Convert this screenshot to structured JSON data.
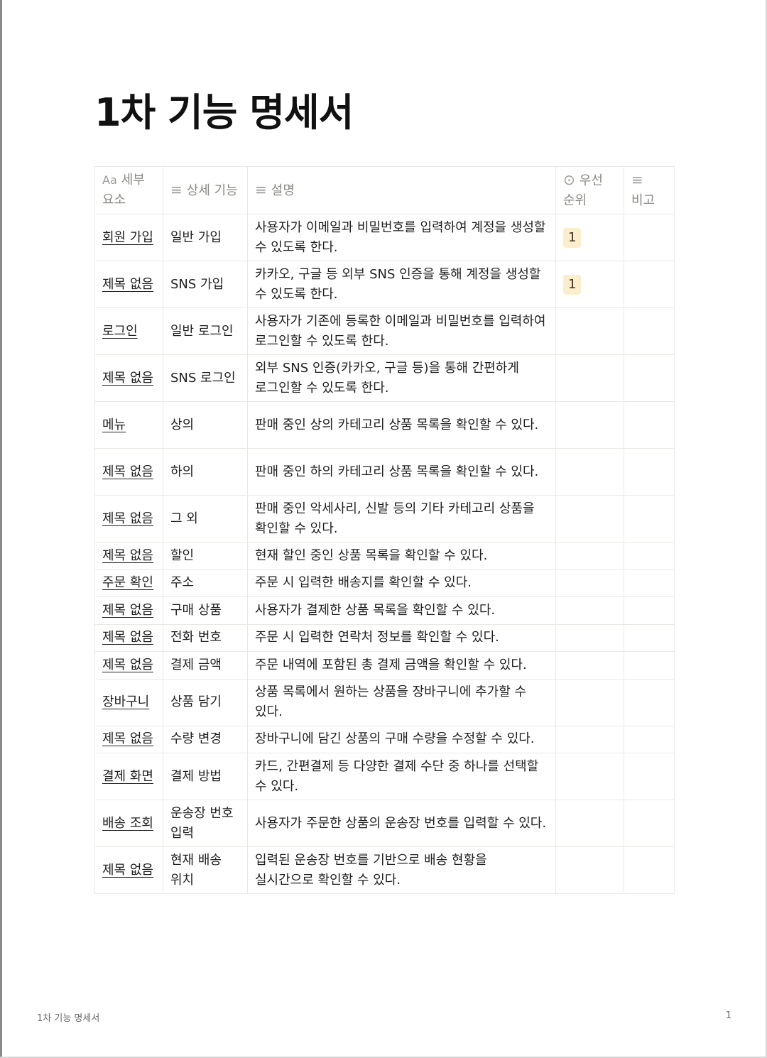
{
  "title": "1차 기능 명세서",
  "columns": [
    {
      "icon": "Aa",
      "label": "세부 요소"
    },
    {
      "icon": "≡",
      "label": "상세 기능"
    },
    {
      "icon": "≡",
      "label": "설명"
    },
    {
      "icon": "⊙",
      "label": "우선 순위"
    },
    {
      "icon": "≡",
      "label": "비고"
    }
  ],
  "rows": [
    {
      "element": "회원 가입",
      "feature": "일반 가입",
      "desc": "사용자가 이메일과 비밀번호를 입력하여 계정을 생성할 수 있도록 한다.",
      "priority": "1",
      "note": ""
    },
    {
      "element": "제목 없음",
      "feature": "SNS 가입",
      "desc": "카카오, 구글 등 외부 SNS 인증을 통해 계정을 생성할 수 있도록 한다.",
      "priority": "1",
      "note": ""
    },
    {
      "element": "로그인",
      "feature": "일반 로그인",
      "desc": "사용자가 기존에 등록한 이메일과 비밀번호를 입력하여 로그인할 수 있도록 한다.",
      "priority": "",
      "note": ""
    },
    {
      "element": "제목 없음",
      "feature": "SNS 로그인",
      "desc": "외부 SNS 인증(카카오, 구글 등)을 통해 간편하게 로그인할 수 있도록 한다.",
      "priority": "",
      "note": ""
    },
    {
      "element": "메뉴",
      "feature": "상의",
      "desc": "판매 중인 상의 카테고리 상품 목록을 확인할 수 있다.",
      "priority": "",
      "note": ""
    },
    {
      "element": "제목 없음",
      "feature": "하의",
      "desc": "판매 중인 하의 카테고리 상품 목록을 확인할 수 있다.",
      "priority": "",
      "note": ""
    },
    {
      "element": "제목 없음",
      "feature": "그 외",
      "desc": "판매 중인 악세사리, 신발 등의 기타 카테고리 상품을 확인할 수 있다.",
      "priority": "",
      "note": ""
    },
    {
      "element": "제목 없음",
      "feature": "할인",
      "desc": "현재 할인 중인 상품 목록을 확인할 수 있다.",
      "priority": "",
      "note": ""
    },
    {
      "element": "주문 확인",
      "feature": "주소",
      "desc": "주문 시 입력한 배송지를 확인할 수 있다.",
      "priority": "",
      "note": ""
    },
    {
      "element": "제목 없음",
      "feature": "구매 상품",
      "desc": "사용자가 결제한 상품 목록을 확인할 수 있다.",
      "priority": "",
      "note": ""
    },
    {
      "element": "제목 없음",
      "feature": "전화 번호",
      "desc": "주문 시 입력한 연락처 정보를 확인할 수 있다.",
      "priority": "",
      "note": ""
    },
    {
      "element": "제목 없음",
      "feature": "결제 금액",
      "desc": "주문 내역에 포함된 총 결제 금액을 확인할 수 있다.",
      "priority": "",
      "note": ""
    },
    {
      "element": "장바구니",
      "feature": "상품 담기",
      "desc": "상품 목록에서 원하는 상품을 장바구니에 추가할 수 있다.",
      "priority": "",
      "note": ""
    },
    {
      "element": "제목 없음",
      "feature": "수량 변경",
      "desc": "장바구니에 담긴 상품의 구매 수량을 수정할 수 있다.",
      "priority": "",
      "note": ""
    },
    {
      "element": "결제 화면",
      "feature": "결제 방법",
      "desc": "카드, 간편결제 등 다양한 결제 수단 중 하나를 선택할 수 있다.",
      "priority": "",
      "note": ""
    },
    {
      "element": "배송 조회",
      "feature": "운송장 번호 입력",
      "desc": "사용자가 주문한 상품의 운송장 번호를 입력할 수 있다.",
      "priority": "",
      "note": ""
    },
    {
      "element": "제목 없음",
      "feature": "현재 배송 위치",
      "desc": "입력된 운송장 번호를 기반으로 배송 현황을 실시간으로 확인할 수 있다.",
      "priority": "",
      "note": ""
    }
  ],
  "footer": {
    "title": "1차 기능 명세서",
    "page": "1"
  }
}
